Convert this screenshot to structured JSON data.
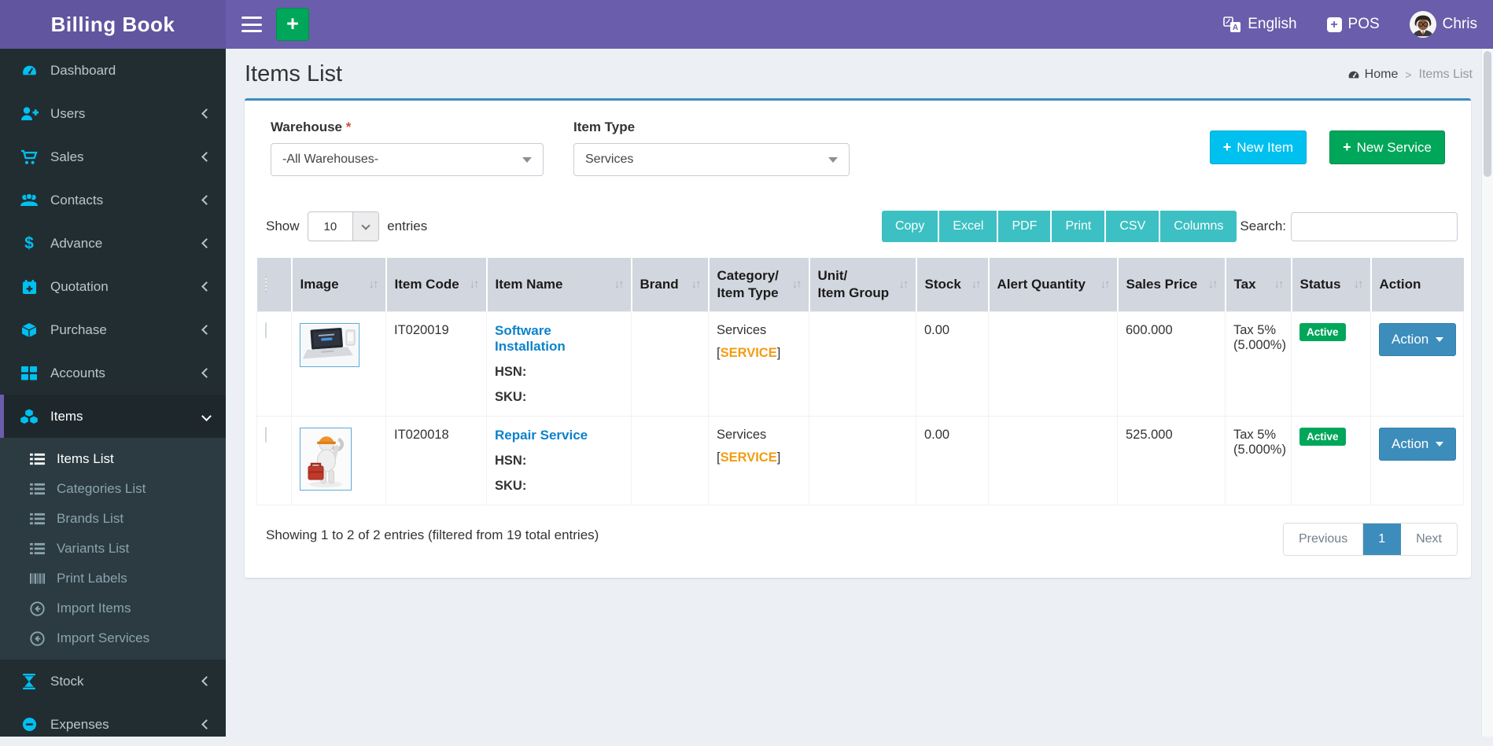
{
  "app": {
    "title": "Billing Book"
  },
  "header": {
    "quick_add_label": "+",
    "language": "English",
    "pos_label": "POS",
    "user_name": "Chris"
  },
  "sidebar": {
    "items": [
      {
        "label": "Dashboard"
      },
      {
        "label": "Users"
      },
      {
        "label": "Sales"
      },
      {
        "label": "Contacts"
      },
      {
        "label": "Advance"
      },
      {
        "label": "Quotation"
      },
      {
        "label": "Purchase"
      },
      {
        "label": "Accounts"
      },
      {
        "label": "Items",
        "active": true,
        "submenu": [
          {
            "label": "Items List",
            "active": true
          },
          {
            "label": "Categories List"
          },
          {
            "label": "Brands List"
          },
          {
            "label": "Variants List"
          },
          {
            "label": "Print Labels"
          },
          {
            "label": "Import Items"
          },
          {
            "label": "Import Services"
          }
        ]
      },
      {
        "label": "Stock"
      },
      {
        "label": "Expenses"
      }
    ]
  },
  "page": {
    "title": "Items List",
    "breadcrumb": {
      "home": "Home",
      "separator": ">",
      "current": "Items List"
    }
  },
  "filters": {
    "warehouse": {
      "label": "Warehouse",
      "required_mark": "*",
      "value": "-All Warehouses-"
    },
    "item_type": {
      "label": "Item Type",
      "value": "Services"
    }
  },
  "actions": {
    "plus": "+",
    "new_item": "New Item",
    "new_service": "New Service"
  },
  "datatable": {
    "show_label": "Show",
    "page_length": "10",
    "entries_label": "entries",
    "export_buttons": [
      "Copy",
      "Excel",
      "PDF",
      "Print",
      "CSV",
      "Columns"
    ],
    "search_label": "Search:",
    "columns": [
      {
        "label": ""
      },
      {
        "label": "Image"
      },
      {
        "label": "Item Code"
      },
      {
        "label": "Item Name"
      },
      {
        "label": "Brand"
      },
      {
        "label": "Category/\nItem Type"
      },
      {
        "label": "Unit/\nItem Group"
      },
      {
        "label": "Stock"
      },
      {
        "label": "Alert Quantity"
      },
      {
        "label": "Sales Price"
      },
      {
        "label": "Tax"
      },
      {
        "label": "Status"
      },
      {
        "label": "Action"
      }
    ],
    "labels": {
      "hsn": "HSN:",
      "sku": "SKU:",
      "bracket_open": "[",
      "bracket_close": "]"
    },
    "rows": [
      {
        "image": "laptop-photo",
        "item_code": "IT020019",
        "item_name": "Software Installation",
        "brand": "",
        "category": "Services",
        "category_tag": "SERVICE",
        "unit_group": "",
        "stock": "0.00",
        "alert_quantity": "",
        "sales_price": "600.000",
        "tax": "Tax 5% (5.000%)",
        "status": "Active",
        "action_label": "Action"
      },
      {
        "image": "repair-service-photo",
        "item_code": "IT020018",
        "item_name": "Repair Service",
        "brand": "",
        "category": "Services",
        "category_tag": "SERVICE",
        "unit_group": "",
        "stock": "0.00",
        "alert_quantity": "",
        "sales_price": "525.000",
        "tax": "Tax 5% (5.000%)",
        "status": "Active",
        "action_label": "Action"
      }
    ],
    "info": "Showing 1 to 2 of 2 entries (filtered from 19 total entries)",
    "pagination": {
      "previous": "Previous",
      "page": "1",
      "next": "Next"
    }
  },
  "colors": {
    "header_purple": "#6a5dab",
    "logo_purple": "#61559f",
    "sidebar_bg": "#222d32",
    "submenu_bg": "#2c3b41",
    "icon_cyan": "#00c0ef",
    "success_green": "#00a65a",
    "export_teal": "#3cc0c3",
    "primary_blue": "#3c8dbc",
    "card_top_border": "#3c8dbc",
    "tag_orange": "#f39c12",
    "link_blue": "#0c82cb",
    "table_header_gray": "#d2d6de"
  }
}
